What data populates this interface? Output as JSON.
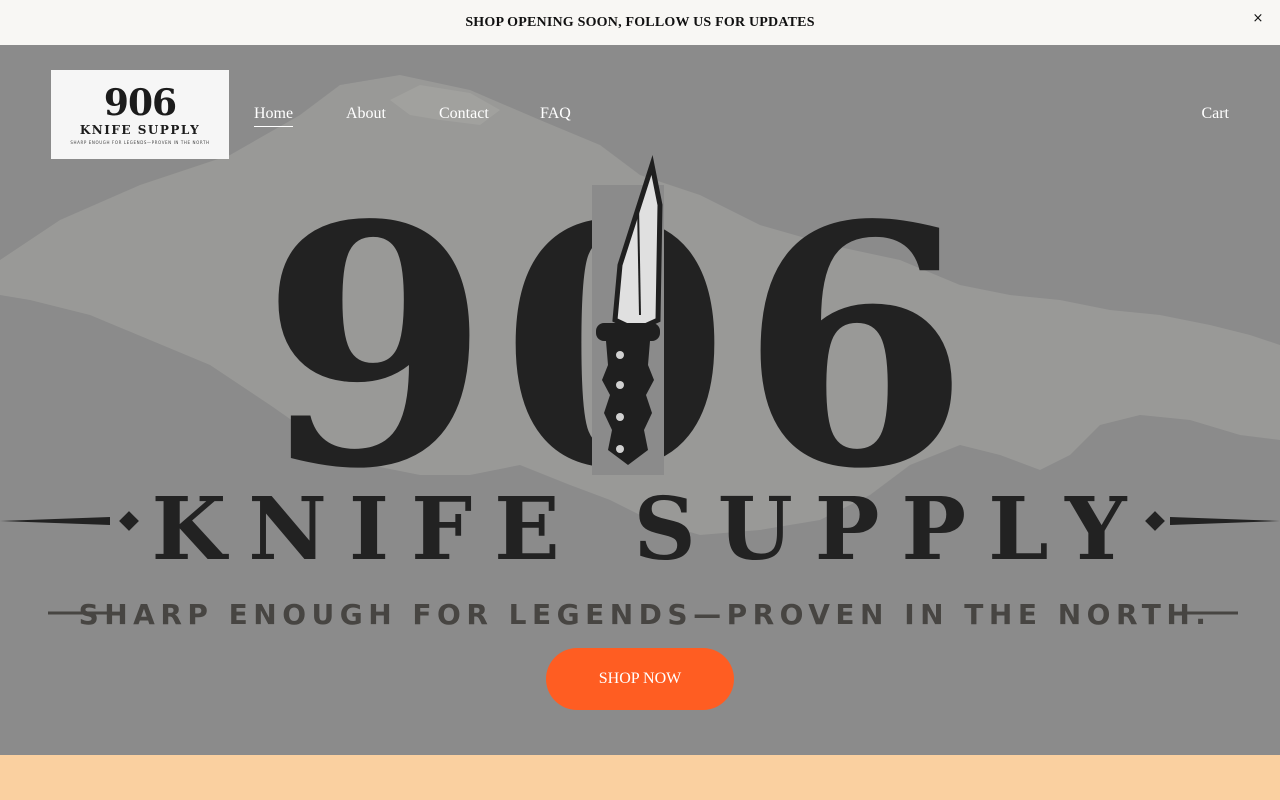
{
  "announcement": {
    "text": "SHOP OPENING SOON, FOLLOW US FOR UPDATES",
    "close_label": "×"
  },
  "brand": {
    "logo_number": "906",
    "logo_name": "KNIFE SUPPLY",
    "logo_tagline": "SHARP ENOUGH FOR LEGENDS—PROVEN IN THE NORTH",
    "hero_number": "906",
    "hero_name": "KNIFE SUPPLY",
    "hero_tagline": "SHARP ENOUGH FOR LEGENDS—PROVEN IN THE NORTH."
  },
  "nav": {
    "items": [
      {
        "label": "Home",
        "active": true
      },
      {
        "label": "About",
        "active": false
      },
      {
        "label": "Contact",
        "active": false
      },
      {
        "label": "FAQ",
        "active": false
      }
    ],
    "cart_label": "Cart"
  },
  "hero": {
    "cta_label": "SHOP NOW"
  },
  "colors": {
    "announcement_bg": "#f8f7f4",
    "hero_overlay": "#8b8b8b",
    "cta": "#ff5d22",
    "footer_band": "#fad0a0",
    "logo_ink": "#1c1c1c"
  }
}
